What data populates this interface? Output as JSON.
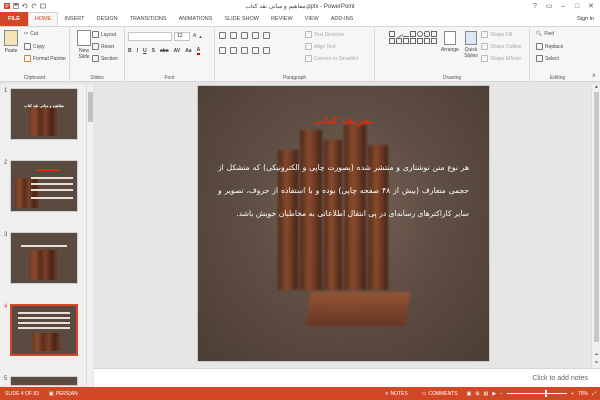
{
  "window": {
    "title": "مفاهیم و مبانی نقد کتاب.pptx - PowerPoint",
    "signin": "Sign in"
  },
  "tabs": [
    {
      "label": "FILE"
    },
    {
      "label": "HOME"
    },
    {
      "label": "INSERT"
    },
    {
      "label": "DESIGN"
    },
    {
      "label": "TRANSITIONS"
    },
    {
      "label": "ANIMATIONS"
    },
    {
      "label": "SLIDE SHOW"
    },
    {
      "label": "REVIEW"
    },
    {
      "label": "VIEW"
    },
    {
      "label": "ADD-INS"
    }
  ],
  "ribbon": {
    "clipboard": {
      "paste": "Paste",
      "cut": "Cut",
      "copy": "Copy",
      "format_painter": "Format Painter",
      "label": "Clipboard"
    },
    "slides": {
      "new_slide": "New Slide",
      "layout": "Layout",
      "reset": "Reset",
      "section": "Section",
      "label": "Slides"
    },
    "font": {
      "size": "12",
      "label": "Font"
    },
    "paragraph": {
      "text_direction": "Text Direction",
      "align_text": "Align Text",
      "convert_smartart": "Convert to SmartArt",
      "label": "Paragraph"
    },
    "drawing": {
      "arrange": "Arrange",
      "quick_styles": "Quick Styles",
      "shape_fill": "Shape Fill",
      "shape_outline": "Shape Outline",
      "shape_effects": "Shape Effects",
      "label": "Drawing"
    },
    "editing": {
      "find": "Find",
      "replace": "Replace",
      "select": "Select",
      "label": "Editing"
    }
  },
  "thumbnails": [
    {
      "num": "1",
      "text": "مفاهیم و مبانی نقد کتاب"
    },
    {
      "num": "2",
      "text": ""
    },
    {
      "num": "3",
      "text": ""
    },
    {
      "num": "4",
      "text": ""
    },
    {
      "num": "5",
      "text": ""
    }
  ],
  "slide": {
    "title": "تعریف کتاب",
    "body": "هر نوع متن نوشتاری و منتشر شده (بصورت چاپی و الکترونیکی) که متشکل از حجمی متعارف (بیش از ۴۸ صفحه چاپی) بوده و با استفاده از حروف، تصویر و سایر کاراکترهای رسانه‌ای در پی انتقال اطلاعاتی به مخاطبان خویش باشد."
  },
  "notes": {
    "placeholder": "Click to add notes"
  },
  "status": {
    "slide": "SLIDE 4 OF 83",
    "language": "PERSIAN",
    "notes": "NOTES",
    "comments": "COMMENTS",
    "zoom": "70%"
  },
  "colors": {
    "accent": "#d24726",
    "slide_title": "#e02a10"
  }
}
